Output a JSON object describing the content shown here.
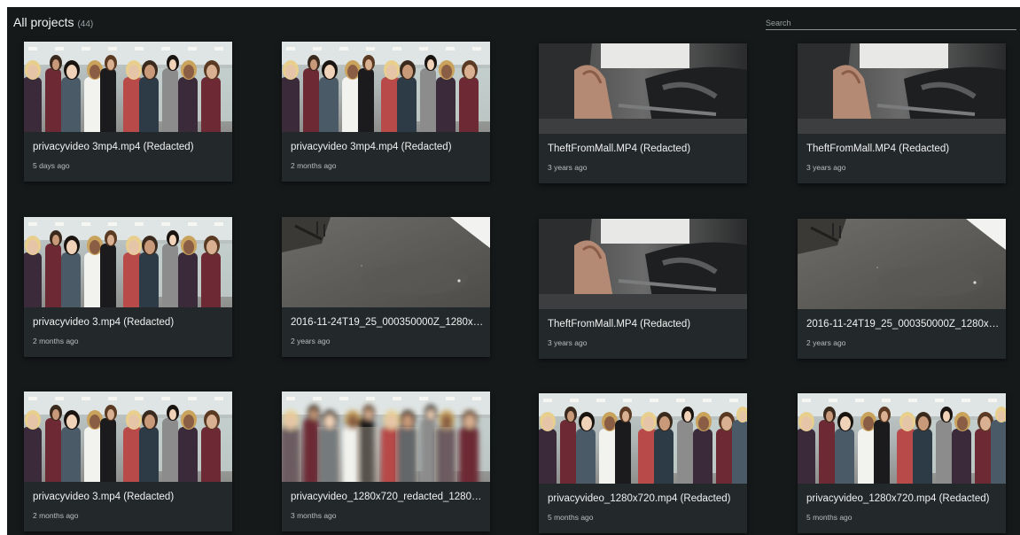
{
  "header": {
    "title": "All projects",
    "count": "(44)",
    "search_placeholder": "Search"
  },
  "projects": [
    {
      "title": "privacyvideo 3mp4.mp4 (Redacted)",
      "date": "5 days ago",
      "thumbnail": "crowd"
    },
    {
      "title": "privacyvideo 3mp4.mp4 (Redacted)",
      "date": "2 months ago",
      "thumbnail": "crowd"
    },
    {
      "title": "TheftFromMall.MP4 (Redacted)",
      "date": "3 years ago",
      "thumbnail": "car-interior"
    },
    {
      "title": "TheftFromMall.MP4 (Redacted)",
      "date": "3 years ago",
      "thumbnail": "car-interior"
    },
    {
      "title": "privacyvideo 3.mp4 (Redacted)",
      "date": "2 months ago",
      "thumbnail": "crowd"
    },
    {
      "title": "2016-11-24T19_25_000350000Z_1280x7...",
      "date": "2 years ago",
      "thumbnail": "garage-floor"
    },
    {
      "title": "TheftFromMall.MP4 (Redacted)",
      "date": "3 years ago",
      "thumbnail": "car-interior"
    },
    {
      "title": "2016-11-24T19_25_000350000Z_1280x7...",
      "date": "2 years ago",
      "thumbnail": "garage-floor"
    },
    {
      "title": "privacyvideo 3.mp4 (Redacted)",
      "date": "2 months ago",
      "thumbnail": "crowd"
    },
    {
      "title": "privacyvideo_1280x720_redacted_1280x...",
      "date": "3 months ago",
      "thumbnail": "crowd-blurred"
    },
    {
      "title": "privacyvideo_1280x720.mp4 (Redacted)",
      "date": "5 months ago",
      "thumbnail": "crowd-wide"
    },
    {
      "title": "privacyvideo_1280x720.mp4 (Redacted)",
      "date": "5 months ago",
      "thumbnail": "crowd-wide"
    }
  ]
}
